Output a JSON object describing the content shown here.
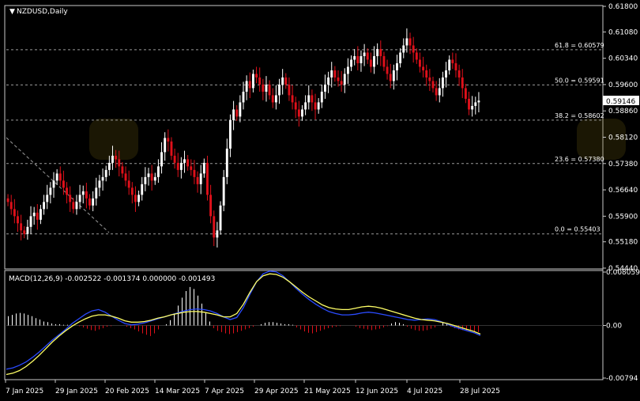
{
  "colors": {
    "background": "#000000",
    "frame": "#c8c8c8",
    "text": "#ffffff",
    "bull": "#ffffff",
    "bear": "#e0101a",
    "fib": "#9a9a9a",
    "macd_line": "#2a4bff",
    "signal_line": "#ffff66",
    "hist_pos": "#ffffff",
    "hist_neg": "#e0101a"
  },
  "price_panel": {
    "title": "NZDUSD,Daily",
    "title_icon": "triangle-down-icon",
    "current_price": "0.59146",
    "price_ticks": [
      "0.61800",
      "0.61080",
      "0.60340",
      "0.59600",
      "0.58860",
      "0.58120",
      "0.57380",
      "0.56640",
      "0.55900",
      "0.55180",
      "0.54440"
    ]
  },
  "macd_panel": {
    "label": "MACD(12,26,9) -0.002522 -0.001374 0.000000 -0.001493",
    "ticks": [
      "0.008059",
      "0.00",
      "-0.00794"
    ]
  },
  "x_labels": [
    "7 Jan 2025",
    "29 Jan 2025",
    "20 Feb 2025",
    "14 Mar 2025",
    "7 Apr 2025",
    "29 Apr 2025",
    "21 May 2025",
    "12 Jun 2025",
    "4 Jul 2025",
    "28 Jul 2025"
  ],
  "chart_data": {
    "type": "candlestick",
    "symbol": "NZDUSD",
    "timeframe": "Daily",
    "ylim": [
      0.5444,
      0.618
    ],
    "macd_ylim": [
      -0.00794,
      0.008059
    ],
    "fib_levels": [
      {
        "label": "61.8 = 0.60579",
        "value": 0.60579
      },
      {
        "label": "50.0 = 0.59591",
        "value": 0.59591
      },
      {
        "label": "38.2 = 0.58602",
        "value": 0.58602
      },
      {
        "label": "23.6 = 0.57380",
        "value": 0.5738
      },
      {
        "label": "0.0 = 0.55403",
        "value": 0.55403
      }
    ],
    "close": [
      0.563,
      0.561,
      0.559,
      0.557,
      0.555,
      0.554,
      0.556,
      0.559,
      0.56,
      0.558,
      0.561,
      0.563,
      0.565,
      0.567,
      0.569,
      0.571,
      0.569,
      0.567,
      0.565,
      0.563,
      0.561,
      0.563,
      0.565,
      0.566,
      0.564,
      0.562,
      0.564,
      0.567,
      0.569,
      0.57,
      0.572,
      0.574,
      0.576,
      0.575,
      0.573,
      0.571,
      0.569,
      0.567,
      0.565,
      0.563,
      0.565,
      0.568,
      0.57,
      0.571,
      0.569,
      0.57,
      0.573,
      0.577,
      0.581,
      0.58,
      0.576,
      0.574,
      0.572,
      0.574,
      0.575,
      0.573,
      0.572,
      0.57,
      0.568,
      0.571,
      0.574,
      0.565,
      0.559,
      0.553,
      0.555,
      0.562,
      0.57,
      0.578,
      0.586,
      0.589,
      0.587,
      0.591,
      0.594,
      0.597,
      0.595,
      0.599,
      0.598,
      0.596,
      0.594,
      0.596,
      0.593,
      0.591,
      0.593,
      0.596,
      0.598,
      0.596,
      0.593,
      0.591,
      0.589,
      0.587,
      0.589,
      0.591,
      0.593,
      0.591,
      0.589,
      0.591,
      0.594,
      0.596,
      0.598,
      0.6,
      0.598,
      0.597,
      0.596,
      0.599,
      0.601,
      0.603,
      0.604,
      0.602,
      0.604,
      0.605,
      0.603,
      0.601,
      0.604,
      0.606,
      0.604,
      0.601,
      0.599,
      0.597,
      0.6,
      0.602,
      0.605,
      0.607,
      0.609,
      0.607,
      0.605,
      0.603,
      0.601,
      0.6,
      0.598,
      0.597,
      0.595,
      0.593,
      0.595,
      0.598,
      0.6,
      0.603,
      0.602,
      0.6,
      0.598,
      0.595,
      0.592,
      0.589,
      0.59,
      0.591,
      0.5915
    ],
    "macd_main": [
      -0.0066,
      -0.0064,
      -0.006,
      -0.0055,
      -0.0048,
      -0.004,
      -0.0031,
      -0.0022,
      -0.0014,
      -0.0006,
      0.0003,
      0.001,
      0.0017,
      0.0022,
      0.0024,
      0.002,
      0.0014,
      0.0008,
      0.0003,
      0.0001,
      0.0002,
      0.0004,
      0.0007,
      0.001,
      0.0013,
      0.0016,
      0.0019,
      0.0022,
      0.0024,
      0.0025,
      0.0024,
      0.0022,
      0.0018,
      0.0013,
      0.0009,
      0.0012,
      0.0027,
      0.0047,
      0.0066,
      0.0078,
      0.0082,
      0.0081,
      0.0075,
      0.0066,
      0.0056,
      0.0047,
      0.0039,
      0.0032,
      0.0026,
      0.0021,
      0.0018,
      0.0016,
      0.0016,
      0.0017,
      0.0019,
      0.002,
      0.0019,
      0.0017,
      0.0015,
      0.0013,
      0.0011,
      0.0009,
      0.0008,
      0.0009,
      0.001,
      0.0009,
      0.0006,
      0.0002,
      -0.0002,
      -0.0005,
      -0.0008,
      -0.0011,
      -0.0015
    ],
    "macd_signal": [
      -0.0074,
      -0.0072,
      -0.0068,
      -0.0062,
      -0.0054,
      -0.0045,
      -0.0035,
      -0.0025,
      -0.0016,
      -0.0008,
      -0.0001,
      0.0005,
      0.001,
      0.0014,
      0.0016,
      0.0016,
      0.0014,
      0.0011,
      0.0007,
      0.0005,
      0.0005,
      0.0006,
      0.0008,
      0.0011,
      0.0013,
      0.0016,
      0.0018,
      0.002,
      0.0021,
      0.0021,
      0.002,
      0.0018,
      0.0016,
      0.0013,
      0.0013,
      0.0018,
      0.0032,
      0.005,
      0.0066,
      0.0075,
      0.0078,
      0.0077,
      0.0073,
      0.0066,
      0.0058,
      0.005,
      0.0043,
      0.0037,
      0.0031,
      0.0027,
      0.0025,
      0.0024,
      0.0024,
      0.0026,
      0.0028,
      0.0029,
      0.0028,
      0.0026,
      0.0023,
      0.002,
      0.0017,
      0.0014,
      0.0011,
      0.0009,
      0.0008,
      0.0007,
      0.0005,
      0.0003,
      0.0,
      -0.0003,
      -0.0006,
      -0.0009,
      -0.0013
    ],
    "macd_hist": [
      0.0014,
      0.0016,
      0.0018,
      0.0019,
      0.0018,
      0.0016,
      0.0014,
      0.0011,
      0.0009,
      0.0006,
      0.0005,
      0.0003,
      0.0002,
      0.0002,
      0.0001,
      0.0001,
      0.0,
      0.0,
      -0.0001,
      -0.0003,
      -0.0005,
      -0.0007,
      -0.0008,
      -0.0006,
      -0.0004,
      -0.0002,
      -0.0001,
      0.0,
      0.0,
      0.0,
      -0.0002,
      -0.0004,
      -0.0006,
      -0.0009,
      -0.0012,
      -0.0014,
      -0.0016,
      -0.0012,
      -0.0006,
      0.0,
      0.0002,
      0.0008,
      0.0018,
      0.003,
      0.0042,
      0.0052,
      0.0058,
      0.0055,
      0.0045,
      0.0033,
      0.002,
      0.0006,
      -0.0004,
      -0.0008,
      -0.001,
      -0.0012,
      -0.0013,
      -0.0012,
      -0.001,
      -0.0008,
      -0.0006,
      -0.0004,
      -0.0002,
      0.0,
      0.0002,
      0.0004,
      0.0005,
      0.0005,
      0.0004,
      0.0003,
      0.0002,
      0.0002,
      0.0001,
      -0.0003,
      -0.0006,
      -0.0009,
      -0.0011,
      -0.0012,
      -0.001,
      -0.0008,
      -0.0006,
      -0.0004,
      -0.0003,
      -0.0002,
      -0.0001,
      0.0,
      0.0,
      0.0,
      -0.0002,
      -0.0004,
      -0.0005,
      -0.0006,
      -0.0007,
      -0.0006,
      -0.0005,
      -0.0003,
      -0.0001,
      0.0003,
      0.0005,
      0.0004,
      0.0002,
      -0.0002,
      -0.0005,
      -0.0007,
      -0.0008,
      -0.0008,
      -0.0007,
      -0.0005,
      -0.0003,
      0.0,
      0.0004,
      0.0003,
      -0.0002,
      -0.0004,
      -0.0006,
      -0.0007,
      -0.0008,
      -0.0008,
      -0.0009,
      -0.001
    ]
  }
}
